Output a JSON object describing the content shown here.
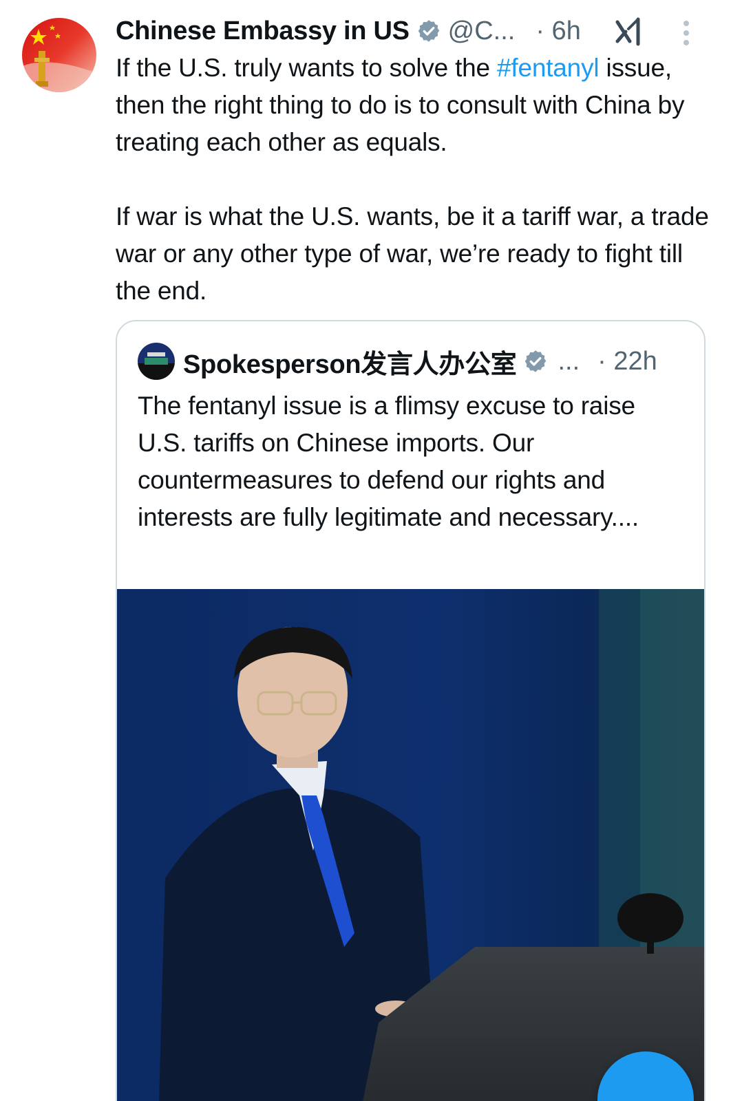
{
  "tweet": {
    "author_name": "Chinese Embassy in US",
    "handle": "@C...",
    "time": "· 6h",
    "text_paragraph_1_before": "If the U.S. truly wants to solve the ",
    "hashtag": "#fentanyl",
    "text_paragraph_1_after": " issue, then the right thing to do is to consult with China by treating each other as equals.",
    "text_paragraph_2": "If war is what the U.S. wants, be it a tariff war, a trade war or any other type of war, we’re ready to fight till the end."
  },
  "quoted_tweet": {
    "author_name": "Spokesperson发言人办公室",
    "handle": "...",
    "time": "· 22h",
    "text": "The fentanyl issue is a flimsy excuse to raise U.S. tariffs on Chinese imports. Our countermeasures to defend our rights and interests are fully legitimate and necessary...."
  },
  "icons": {
    "verified": "verified-badge-icon",
    "grok": "grok-icon",
    "more": "more-options-icon",
    "compose": "compose-fab"
  },
  "colors": {
    "accent": "#1d9bf0",
    "text": "#0f1419",
    "secondary": "#536471",
    "border": "#cfd9de",
    "media_background": "#0e2a5e"
  }
}
